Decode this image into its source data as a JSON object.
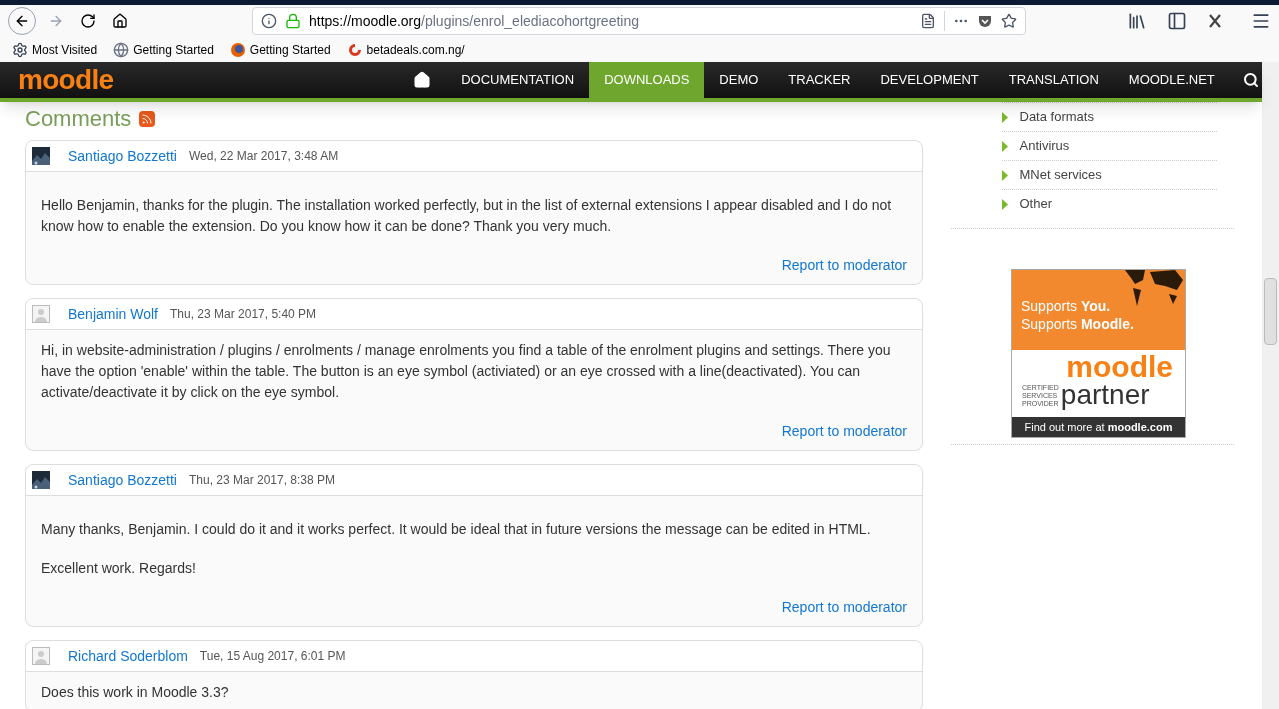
{
  "browser": {
    "url_host": "https://moodle.org",
    "url_path": "/plugins/enrol_elediacohortgreeting",
    "bookmarks": [
      "Most Visited",
      "Getting Started",
      "Getting Started",
      "betadeals.com.ng/"
    ]
  },
  "site": {
    "logo": "moodle",
    "nav": [
      {
        "label": "DOCUMENTATION",
        "selected": false
      },
      {
        "label": "DOWNLOADS",
        "selected": true
      },
      {
        "label": "DEMO",
        "selected": false
      },
      {
        "label": "TRACKER",
        "selected": false
      },
      {
        "label": "DEVELOPMENT",
        "selected": false
      },
      {
        "label": "TRANSLATION",
        "selected": false
      },
      {
        "label": "MOODLE.NET",
        "selected": false
      }
    ]
  },
  "comments_heading": "Comments",
  "comments": [
    {
      "author": "Santiago Bozzetti",
      "date": "Wed, 22 Mar 2017, 3:48 AM",
      "avatar_photo": true,
      "blank_first_line": true,
      "paragraphs": [
        "Hello Benjamin, thanks for the plugin. The installation worked perfectly, but in the list of external extensions I appear disabled and I do not know how to enable the extension. Do you know how it can be done? Thank you very much."
      ],
      "report": "Report to moderator"
    },
    {
      "author": "Benjamin Wolf",
      "date": "Thu, 23 Mar 2017, 5:40 PM",
      "avatar_photo": false,
      "blank_first_line": false,
      "paragraphs": [
        "Hi, in website-administration / plugins / enrolments / manage enrolments you find a table of the enrolment plugins and settings. There you have the option 'enable' within the table. The button is an eye symbol (activiated) or an eye crossed with a line(deactivated). You can activate/deactivate it by click on the eye symbol."
      ],
      "report": "Report to moderator"
    },
    {
      "author": "Santiago Bozzetti",
      "date": "Thu, 23 Mar 2017, 8:38 PM",
      "avatar_photo": true,
      "blank_first_line": true,
      "paragraphs": [
        "Many thanks, Benjamin. I could do it and it works perfect. It would be ideal that in future versions the message can be edited in HTML.",
        "Excellent work. Regards!"
      ],
      "report": "Report to moderator"
    },
    {
      "author": "Richard Soderblom",
      "date": "Tue, 15 Aug 2017, 6:01 PM",
      "avatar_photo": false,
      "blank_first_line": false,
      "paragraphs": [
        "Does this work in Moodle 3.3?"
      ]
    }
  ],
  "sidebar": {
    "items": [
      "Data formats",
      "Antivirus",
      "MNet services",
      "Other"
    ],
    "ad": {
      "line_1": "Supports **You.**",
      "line_2": "Supports **Moodle.**",
      "logo_top": "moodle",
      "logo_small": [
        "CERTIFIED",
        "SERVICES",
        "PROVIDER"
      ],
      "logo_bottom": "partner",
      "footer": "Find out more at **moodle.com**"
    }
  }
}
